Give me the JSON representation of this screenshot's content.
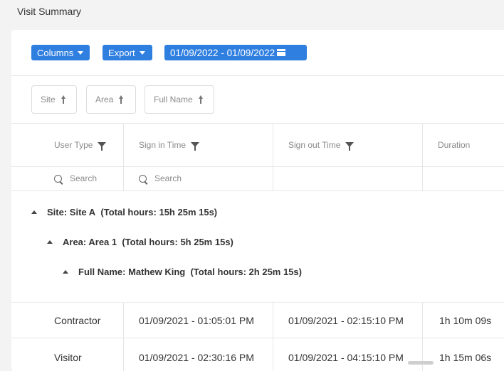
{
  "page": {
    "title": "Visit Summary"
  },
  "toolbar": {
    "columns_label": "Columns",
    "export_label": "Export",
    "date_range": "01/09/2022 - 01/09/2022"
  },
  "grouping": {
    "pills": [
      "Site",
      "Area",
      "Full Name"
    ]
  },
  "table": {
    "headers": [
      "User Type",
      "Sign in Time",
      "Sign out Time",
      "Duration"
    ],
    "search_placeholder": "Search",
    "groups": {
      "site": "Site: Site A",
      "site_total": "(Total hours: 15h 25m 15s)",
      "area": "Area: Area 1",
      "area_total": "(Total hours: 5h 25m 15s)",
      "name": "Full Name: Mathew King",
      "name_total": "(Total hours: 2h 25m 15s)"
    },
    "rows": [
      {
        "user_type": "Contractor",
        "sign_in": "01/09/2021 - 01:05:01 PM",
        "sign_out": "01/09/2021 - 02:15:10 PM",
        "duration": "1h 10m 09s"
      },
      {
        "user_type": "Visitor",
        "sign_in": "01/09/2021 - 02:30:16 PM",
        "sign_out": "01/09/2021 - 04:15:10 PM",
        "duration": "1h 15m 06s"
      }
    ]
  },
  "colors": {
    "accent": "#2f7fe0",
    "background": "#f3f3f4"
  }
}
